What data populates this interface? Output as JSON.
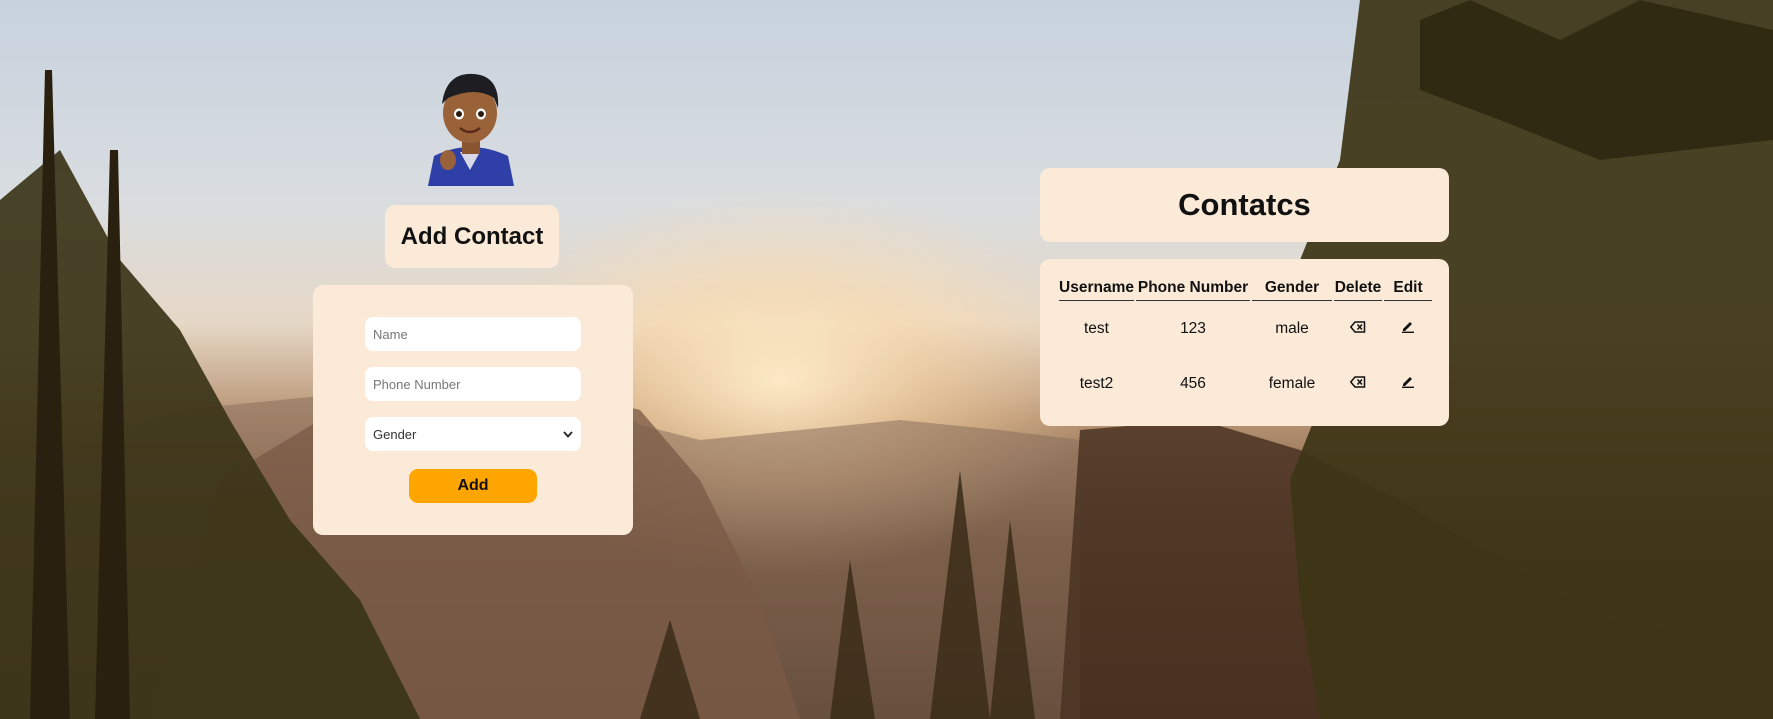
{
  "add_contact": {
    "title": "Add Contact",
    "name_placeholder": "Name",
    "phone_placeholder": "Phone Number",
    "gender_selected": "Gender",
    "add_label": "Add"
  },
  "contacts": {
    "title": "Contatcs",
    "headers": [
      "Username",
      "Phone Number",
      "Gender",
      "Delete",
      "Edit"
    ],
    "rows": [
      {
        "username": "test",
        "phone": "123",
        "gender": "male"
      },
      {
        "username": "test2",
        "phone": "456",
        "gender": "female"
      }
    ]
  },
  "icons": {
    "avatar": "memoji-avatar",
    "delete": "backspace-delete-icon",
    "edit": "pencil-edit-icon"
  },
  "colors": {
    "card_bg": "#fbead7",
    "accent": "#ffa500"
  }
}
